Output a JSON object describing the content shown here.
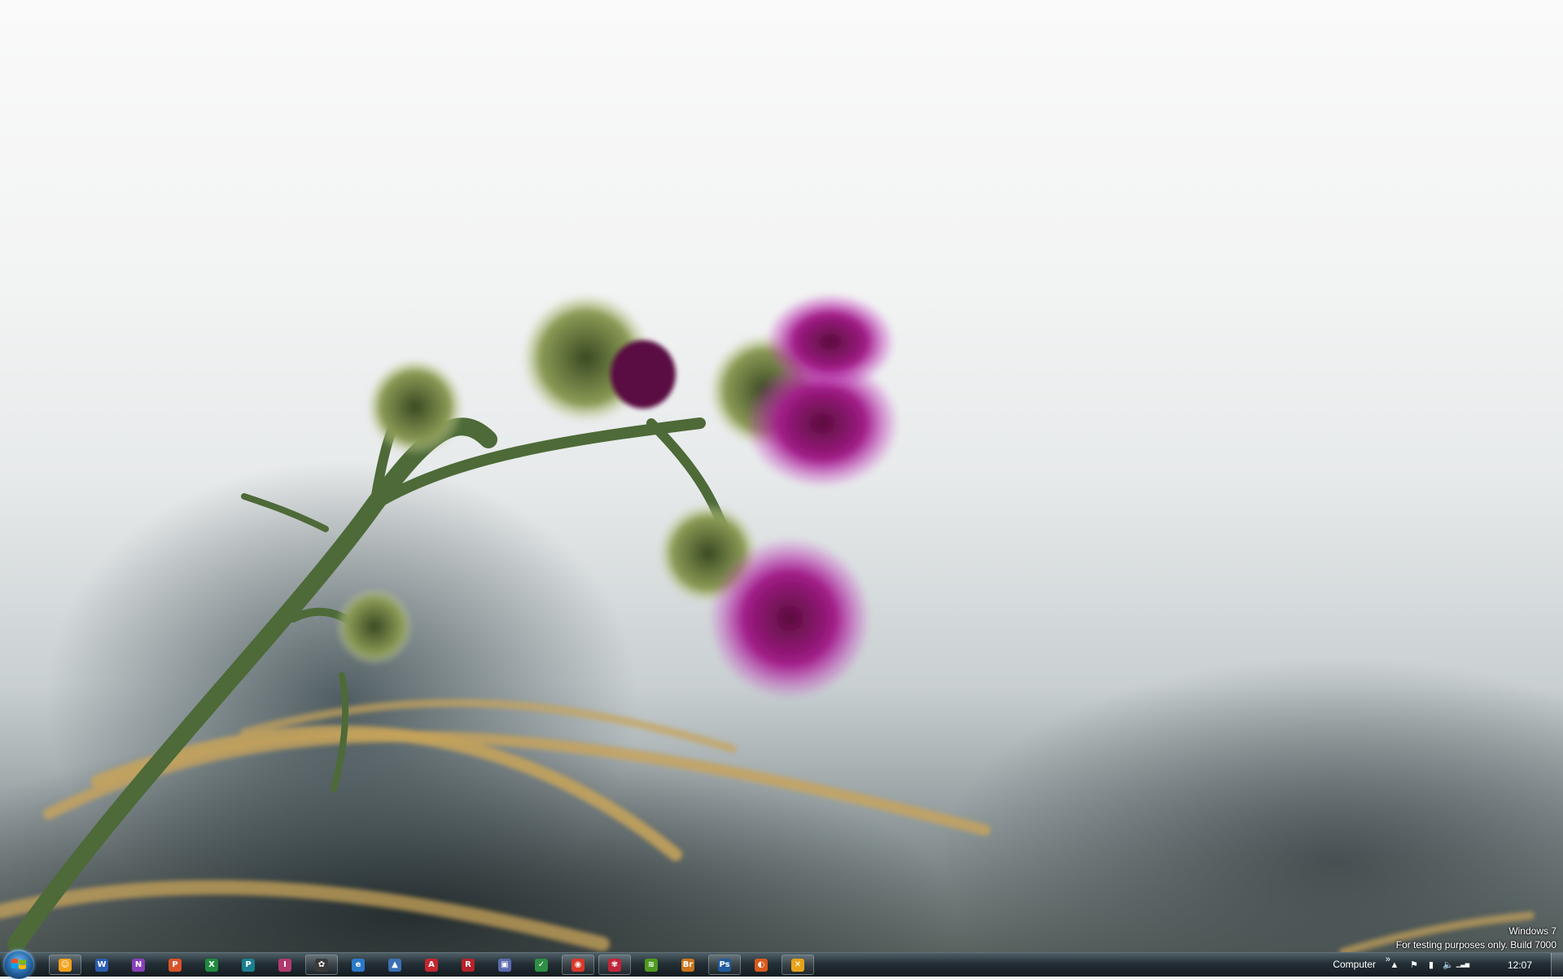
{
  "watermark": {
    "line1": "Windows 7",
    "line2": "For testing purposes only. Build 7000"
  },
  "taskbar": {
    "start_icon": "windows-orb-icon",
    "pinned": [
      {
        "name": "messenger-icon",
        "glyph": "☺",
        "color": "#f3a21a",
        "active": true
      },
      {
        "name": "word-icon",
        "glyph": "W",
        "color": "#2a5db0",
        "active": false
      },
      {
        "name": "onenote-icon",
        "glyph": "N",
        "color": "#8a3fb8",
        "active": false
      },
      {
        "name": "powerpoint-icon",
        "glyph": "P",
        "color": "#d8532a",
        "active": false
      },
      {
        "name": "excel-icon",
        "glyph": "X",
        "color": "#1f8a3e",
        "active": false
      },
      {
        "name": "publisher-icon",
        "glyph": "P",
        "color": "#1a7f8f",
        "active": false
      },
      {
        "name": "infopath-icon",
        "glyph": "I",
        "color": "#b03a6e",
        "active": false
      },
      {
        "name": "media-center-icon",
        "glyph": "✿",
        "color": "#3a3a3a",
        "active": true
      },
      {
        "name": "ie-icon",
        "glyph": "e",
        "color": "#2b78c9",
        "active": false
      },
      {
        "name": "paint-icon",
        "glyph": "▲",
        "color": "#3a6fb5",
        "active": false
      },
      {
        "name": "acrobat-icon",
        "glyph": "A",
        "color": "#c4262e",
        "active": false
      },
      {
        "name": "reader-icon",
        "glyph": "R",
        "color": "#b8212a",
        "active": false
      },
      {
        "name": "photo-viewer-icon",
        "glyph": "▣",
        "color": "#5b6bb0",
        "active": false
      },
      {
        "name": "checker-icon",
        "glyph": "✓",
        "color": "#2e8f44",
        "active": false
      },
      {
        "name": "chrome-icon",
        "glyph": "◉",
        "color": "#d8382a",
        "active": true
      },
      {
        "name": "lotus-icon",
        "glyph": "✾",
        "color": "#c0253a",
        "active": true
      },
      {
        "name": "spotify-icon",
        "glyph": "≋",
        "color": "#4f9a1e",
        "active": false
      },
      {
        "name": "bridge-icon",
        "glyph": "Br",
        "color": "#c9741b",
        "active": false
      },
      {
        "name": "photoshop-icon",
        "glyph": "Ps",
        "color": "#1f5c9e",
        "active": true
      },
      {
        "name": "firefox-icon",
        "glyph": "◐",
        "color": "#d9591c",
        "active": false
      },
      {
        "name": "tools-icon",
        "glyph": "✕",
        "color": "#e8a31a",
        "active": true
      }
    ],
    "toolbar_label": "Computer",
    "toolbar_chevron": "»",
    "tray_icons": [
      {
        "name": "show-hidden-icons-icon",
        "glyph": "▲"
      },
      {
        "name": "action-center-flag-icon",
        "glyph": "⚑"
      },
      {
        "name": "power-icon",
        "glyph": "▮"
      },
      {
        "name": "volume-icon",
        "glyph": "🔈"
      },
      {
        "name": "network-signal-icon",
        "glyph": "▁▃▅"
      }
    ],
    "clock": "12:07"
  }
}
